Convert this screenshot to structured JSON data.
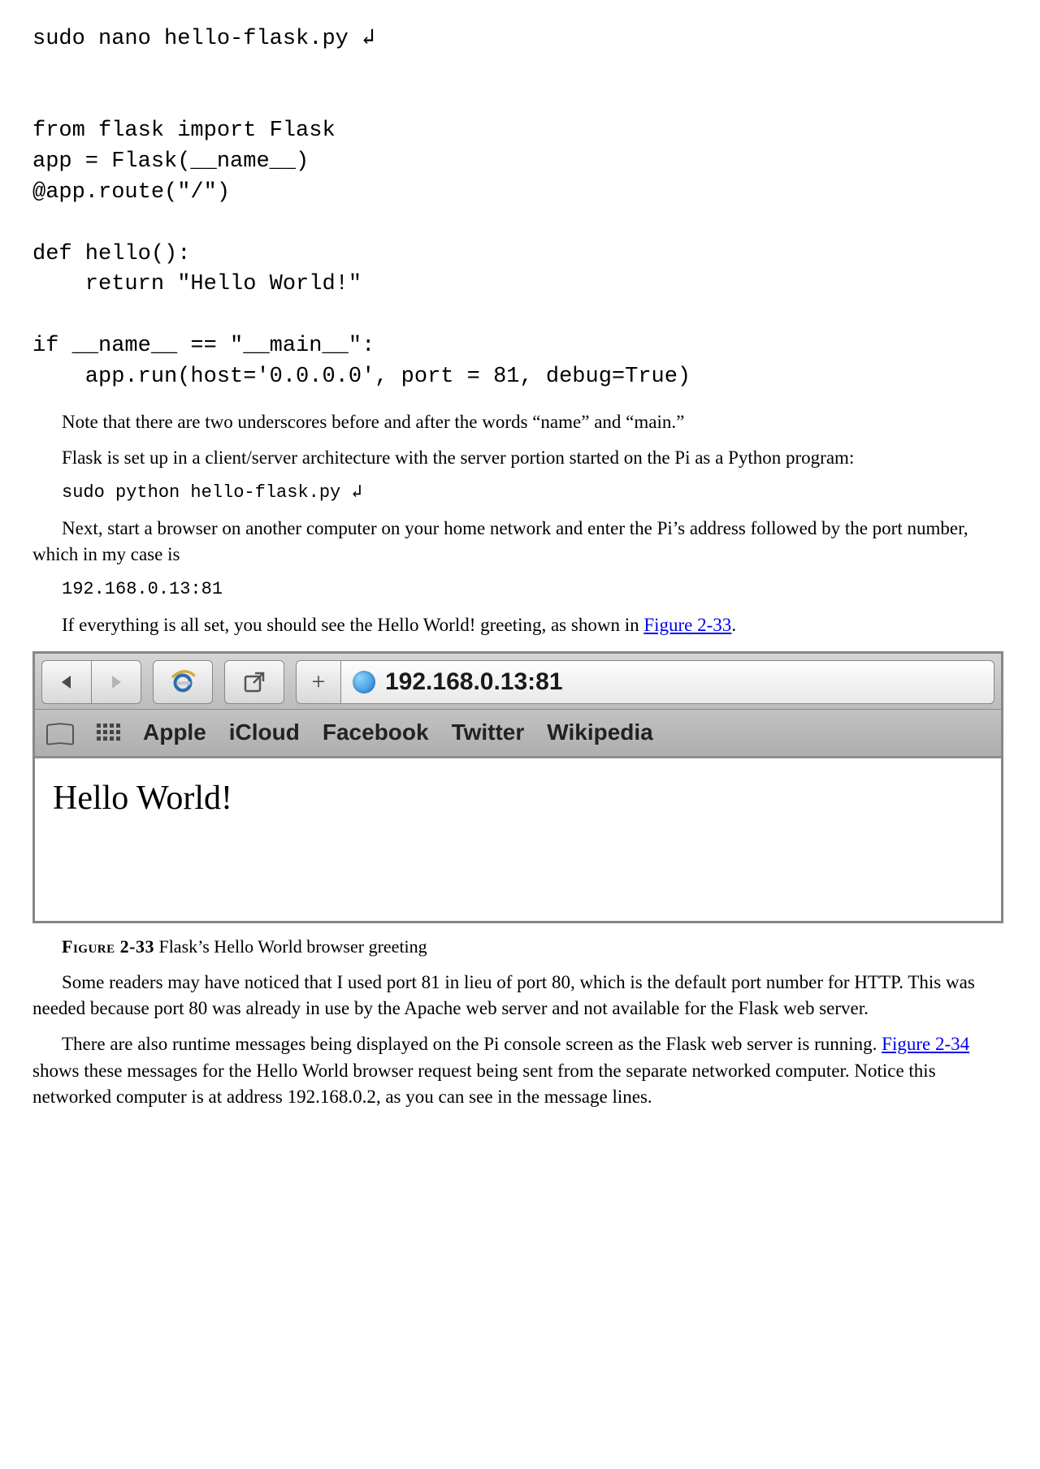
{
  "code_block_1": "sudo nano hello-flask.py ↲\n\n\nfrom flask import Flask\napp = Flask(__name__)\n@app.route(\"/\")\n\ndef hello():\n    return \"Hello World!\"\n\nif __name__ == \"__main__\":\n    app.run(host='0.0.0.0', port = 81, debug=True)",
  "para_note_underscores": "Note that there are two underscores before and after the words “name” and “main.”",
  "para_client_server": "Flask is set up in a client/server architecture with the server portion started on the Pi as a Python program:",
  "code_sudo_python": "sudo python hello-flask.py ↲",
  "para_start_browser": "Next, start a browser on another computer on your home network and enter the Pi’s address followed by the port number, which in my case is",
  "code_address": "192.168.0.13:81",
  "para_if_everything_pre": "If everything is all set, you should see the Hello World! greeting, as shown in ",
  "link_fig_233": "Figure 2-33",
  "para_if_everything_post": ".",
  "browser": {
    "url": "192.168.0.13:81",
    "bookmarks": [
      "Apple",
      "iCloud",
      "Facebook",
      "Twitter",
      "Wikipedia"
    ],
    "page_text": "Hello World!"
  },
  "fig_caption_label": "Figure 2-33",
  "fig_caption_text": " Flask’s Hello World browser greeting",
  "para_port81": "Some readers may have noticed that I used port 81 in lieu of port 80, which is the default port number for HTTP. This was needed because port 80 was already in use by the Apache web server and not available for the Flask web server.",
  "para_runtime_pre": "There are also runtime messages being displayed on the Pi console screen as the Flask web server is running. ",
  "link_fig_234": "Figure 2-34",
  "para_runtime_post": " shows these messages for the Hello World browser request being sent from the separate networked computer. Notice this networked computer is at address 192.168.0.2, as you can see in the message lines."
}
